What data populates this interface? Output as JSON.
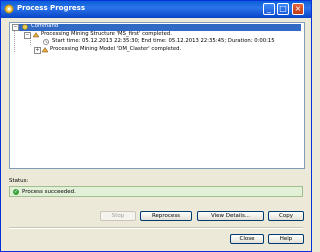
{
  "window": {
    "title": "Process Progress"
  },
  "tree": {
    "root": {
      "label": "Command"
    },
    "structure": {
      "label": "Processing Mining Structure 'MS_first' completed."
    },
    "timing": {
      "label": "Start time: 05.12.2013 22:35:30; End time: 05.12.2013 22:35:45; Duration: 0:00:15"
    },
    "model": {
      "label": "Processing Mining Model 'DM_Claster' completed."
    }
  },
  "status": {
    "label": "Status:",
    "text": "Process succeeded."
  },
  "buttons": {
    "stop": "Stop",
    "reprocess": "Reprocess",
    "view_details": "View Details...",
    "copy": "Copy",
    "close": "Close",
    "help": "Help"
  }
}
